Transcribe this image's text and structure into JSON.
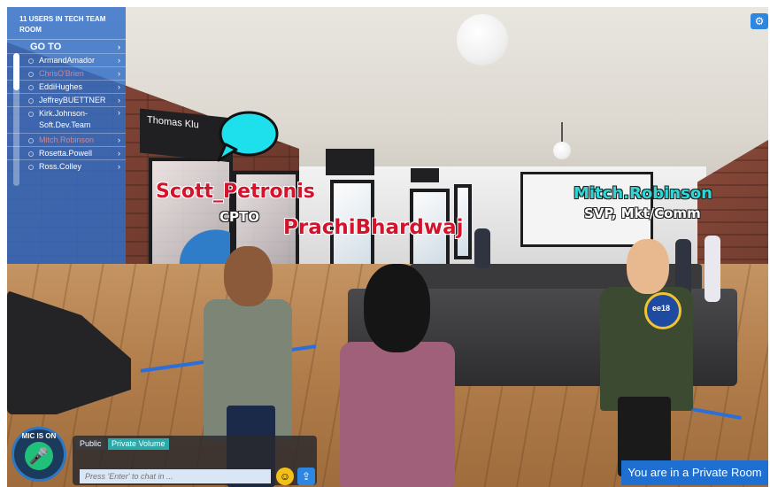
{
  "user_panel": {
    "title": "11 USERS IN TECH TEAM ROOM",
    "goto_label": "GO TO",
    "users": [
      {
        "name": "ArmandAmador",
        "dim": false
      },
      {
        "name": "ChrisO'Brien",
        "dim": true
      },
      {
        "name": "EddiHughes",
        "dim": false
      },
      {
        "name": "JeffreyBUETTNER",
        "dim": false
      },
      {
        "name": "Kirk.Johnson-Soft.Dev.Team",
        "dim": false
      },
      {
        "name": "Mitch.Robinson",
        "dim": true
      },
      {
        "name": "Rosetta.Powell",
        "dim": false
      },
      {
        "name": "Ross.Colley",
        "dim": false
      }
    ]
  },
  "scene": {
    "wall_sign": "Thomas Klu",
    "floating_names": {
      "scott": {
        "name": "Scott_Petronis",
        "role": "CPTO"
      },
      "prachi": {
        "name": "PrachiBhardwaj"
      },
      "mitch": {
        "name": "Mitch.Robinson",
        "role": "SVP, Mkt/Comm"
      }
    },
    "badge_text": "ee18"
  },
  "mic": {
    "label": "MIC IS ON",
    "icon": "microphone-icon"
  },
  "chat": {
    "tab_public": "Public",
    "tab_private": "Private Volume",
    "input_placeholder": "Press 'Enter' to chat in ...",
    "emoji_icon": "smiley-icon",
    "share_icon": "upload-icon"
  },
  "private_banner": "You are in a Private Room",
  "colors": {
    "panel": "#306ec8",
    "red_name": "#d4142c",
    "cyan_name": "#2fd6d6",
    "banner": "#1f6fd0"
  }
}
